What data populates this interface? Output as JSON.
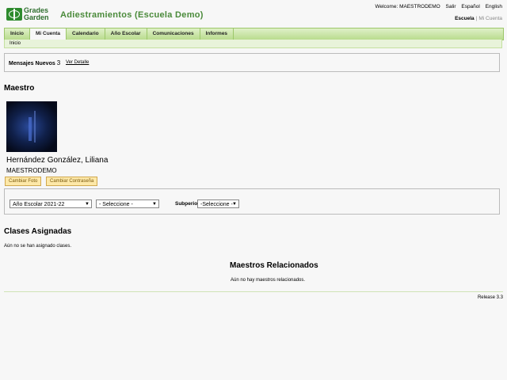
{
  "logo": {
    "text": "Grades Garden",
    "icon": "globe-logo-icon"
  },
  "app_title": "Adiestramientos (Escuela Demo)",
  "top_links": {
    "welcome": "Welcome: MAESTRODEMO",
    "logout": "Salir",
    "spanish": "Español",
    "english": "English"
  },
  "context": {
    "school": "Escuela",
    "separator": "|",
    "account": "Mi Cuenta"
  },
  "nav": {
    "tabs": [
      "Inicio",
      "Mi Cuenta",
      "Calendario",
      "Año Escolar",
      "Comunicaciones",
      "Informes"
    ],
    "active": "Mi Cuenta"
  },
  "breadcrumb": "Inicio",
  "messages": {
    "label": "Mensajes Nuevos",
    "count": "3",
    "link": "Ver Detalle"
  },
  "teacher": {
    "heading": "Maestro",
    "name": "Hernández González, Liliana",
    "username": "MAESTRODEMO",
    "change_photo": "Cambiar Foto",
    "change_password": "Cambiar Contraseña"
  },
  "filters": {
    "school_year": "Año Escolar 2021-22",
    "select_default": "- Seleccione -",
    "subperiod_label": "Subperiodo",
    "subperiod_default": "-Seleccione -"
  },
  "classes": {
    "heading": "Clases Asignadas",
    "empty": "Aún no se han asignado clases."
  },
  "related": {
    "heading": "Maestros Relacionados",
    "empty": "Aún no hay maestros relacionados."
  },
  "footer": {
    "release": "Release 3.3"
  },
  "colors": {
    "nav_green": "#b9dc8e",
    "title_green": "#4a8a3a",
    "button_yellow": "#fde8a8"
  }
}
